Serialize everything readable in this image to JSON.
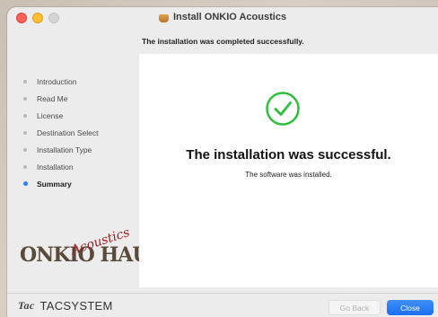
{
  "window": {
    "title": "Install ONKIO Acoustics",
    "subtitle": "The installation was completed successfully."
  },
  "sidebar": {
    "steps": [
      {
        "label": "Introduction",
        "active": false
      },
      {
        "label": "Read Me",
        "active": false
      },
      {
        "label": "License",
        "active": false
      },
      {
        "label": "Destination Select",
        "active": false
      },
      {
        "label": "Installation Type",
        "active": false
      },
      {
        "label": "Installation",
        "active": false
      },
      {
        "label": "Summary",
        "active": true
      }
    ],
    "logo": {
      "main": "ONKIO HAUS",
      "script": "Acoustics"
    }
  },
  "main": {
    "headline": "The installation was successful.",
    "message": "The software was installed.",
    "check_icon": "checkmark-circle-icon"
  },
  "footer": {
    "brand": "TACSYSTEM",
    "brand_mark": "Tac",
    "back_label": "Go Back",
    "close_label": "Close"
  },
  "colors": {
    "accent": "#1b6ef0",
    "success": "#2fbf3a",
    "active_dot": "#2e7cf6"
  }
}
